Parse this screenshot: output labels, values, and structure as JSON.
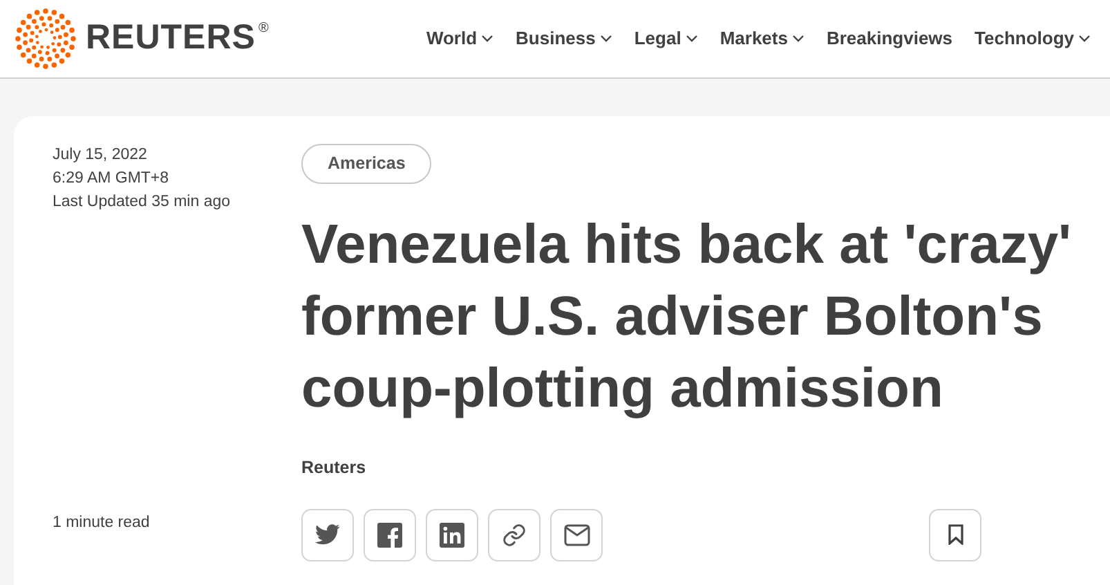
{
  "header": {
    "brand": "REUTERS",
    "registered_mark": "®",
    "nav": [
      {
        "label": "World",
        "dropdown": true
      },
      {
        "label": "Business",
        "dropdown": true
      },
      {
        "label": "Legal",
        "dropdown": true
      },
      {
        "label": "Markets",
        "dropdown": true
      },
      {
        "label": "Breakingviews",
        "dropdown": false
      },
      {
        "label": "Technology",
        "dropdown": true
      }
    ]
  },
  "article": {
    "date": "July 15, 2022",
    "time": "6:29 AM GMT+8",
    "updated": "Last Updated 35 min ago",
    "section": "Americas",
    "headline": "Venezuela hits back at 'crazy' former U.S. adviser Bolton's coup-plotting admission",
    "byline": "Reuters",
    "read_time": "1 minute read",
    "share_buttons": [
      {
        "kind": "twitter"
      },
      {
        "kind": "facebook"
      },
      {
        "kind": "linkedin"
      },
      {
        "kind": "link"
      },
      {
        "kind": "email"
      }
    ],
    "bookmark": {
      "kind": "bookmark"
    }
  }
}
